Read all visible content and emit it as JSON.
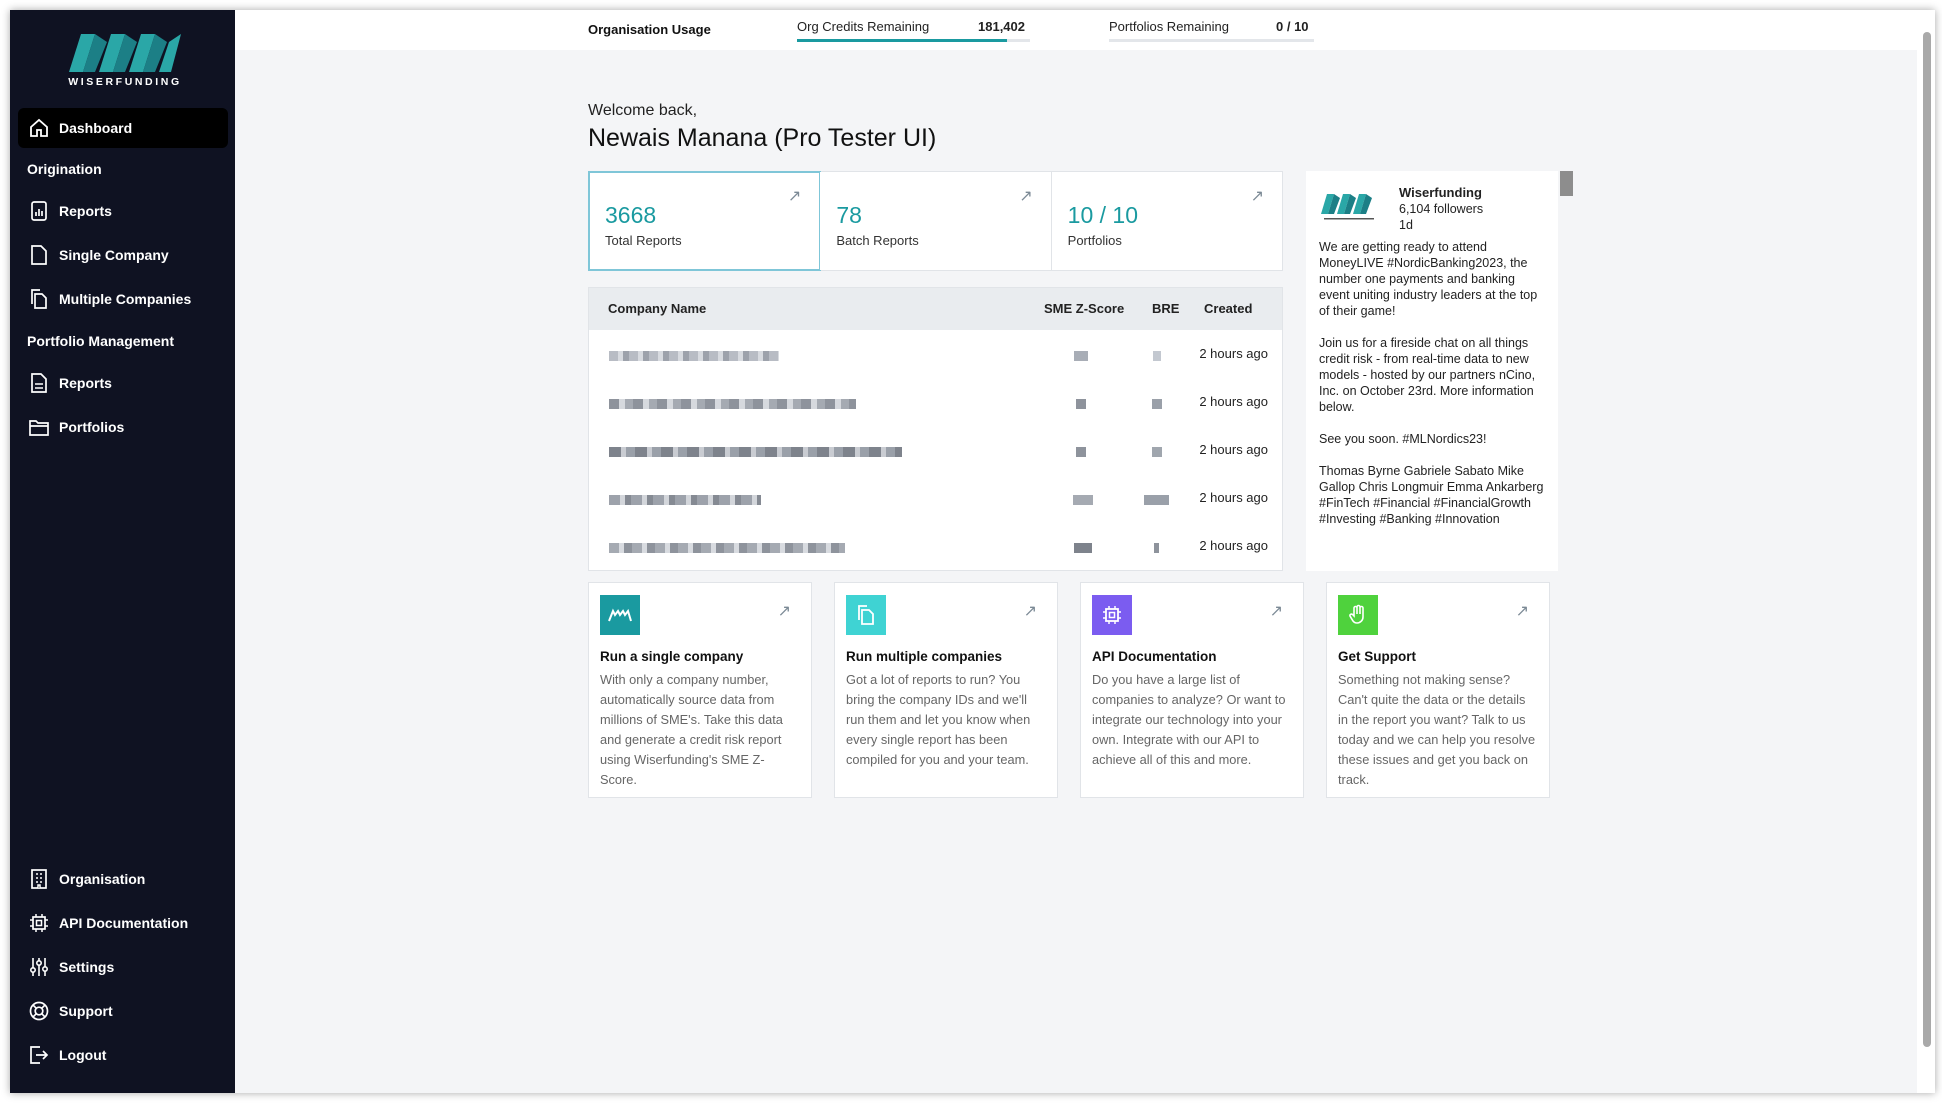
{
  "brand": {
    "name": "WISERFUNDING",
    "accent": "#1a9aa0",
    "logo_color": "#2aa7a7"
  },
  "sidebar": {
    "dashboard": "Dashboard",
    "section_origination": "Origination",
    "origination_items": [
      "Reports",
      "Single Company",
      "Multiple Companies"
    ],
    "section_portfolio": "Portfolio Management",
    "portfolio_items": [
      "Reports",
      "Portfolios"
    ],
    "bottom_items": [
      "Organisation",
      "API Documentation",
      "Settings",
      "Support",
      "Logout"
    ]
  },
  "usage": {
    "title": "Organisation Usage",
    "credits_label": "Org Credits Remaining",
    "credits_value": "181,402",
    "credits_fill": 0.9,
    "portfolios_label": "Portfolios Remaining",
    "portfolios_value": "0 / 10",
    "portfolios_fill": 0
  },
  "welcome": "Welcome back,",
  "user_name": "Newais Manana (Pro Tester UI)",
  "stats": [
    {
      "value": "3668",
      "label": "Total Reports"
    },
    {
      "value": "78",
      "label": "Batch Reports"
    },
    {
      "value": "10 / 10",
      "label": "Portfolios"
    }
  ],
  "table": {
    "headers": {
      "company": "Company Name",
      "zscore": "SME Z-Score",
      "bre": "BRE",
      "created": "Created"
    },
    "rows": [
      {
        "created": "2 hours ago"
      },
      {
        "created": "2 hours ago"
      },
      {
        "created": "2 hours ago"
      },
      {
        "created": "2 hours ago"
      },
      {
        "created": "2 hours ago"
      }
    ]
  },
  "news": {
    "name": "Wiserfunding",
    "followers": "6,104 followers",
    "time": "1d",
    "paragraphs": [
      "We are getting ready to attend MoneyLIVE #NordicBanking2023, the number one payments and banking event uniting industry leaders at the top of their game!",
      "Join us for a fireside chat on all things credit risk - from real-time data to new models - hosted by our partners nCino, Inc. on October 23rd. More information below.",
      "See you soon. #MLNordics23!",
      "Thomas Byrne Gabriele Sabato Mike Gallop Chris Longmuir Emma Ankarberg #FinTech #Financial #FinancialGrowth #Investing #Banking #Innovation"
    ]
  },
  "cards": [
    {
      "title": "Run a single company",
      "desc": "With only a company number, automatically source data from millions of SME's. Take this data and generate a credit risk report using Wiserfunding's SME Z-Score.",
      "color": "#1a9aa0",
      "icon": "wiserfunding-logo-icon"
    },
    {
      "title": "Run multiple companies",
      "desc": "Got a lot of reports to run? You bring the company IDs and we'll run them and let you know when every single report has been compiled for you and your team.",
      "color": "#3fd3d3",
      "icon": "copy-icon"
    },
    {
      "title": "API Documentation",
      "desc": "Do you have a large list of companies to analyze? Or want to integrate our technology into your own. Integrate with our API to achieve all of this and more.",
      "color": "#7b5cf0",
      "icon": "chip-icon"
    },
    {
      "title": "Get Support",
      "desc": "Something not making sense? Can't quite the data or the details in the report you want? Talk to us today and we can help you resolve these issues and get you back on track.",
      "color": "#4fd23d",
      "icon": "hand-icon"
    }
  ]
}
